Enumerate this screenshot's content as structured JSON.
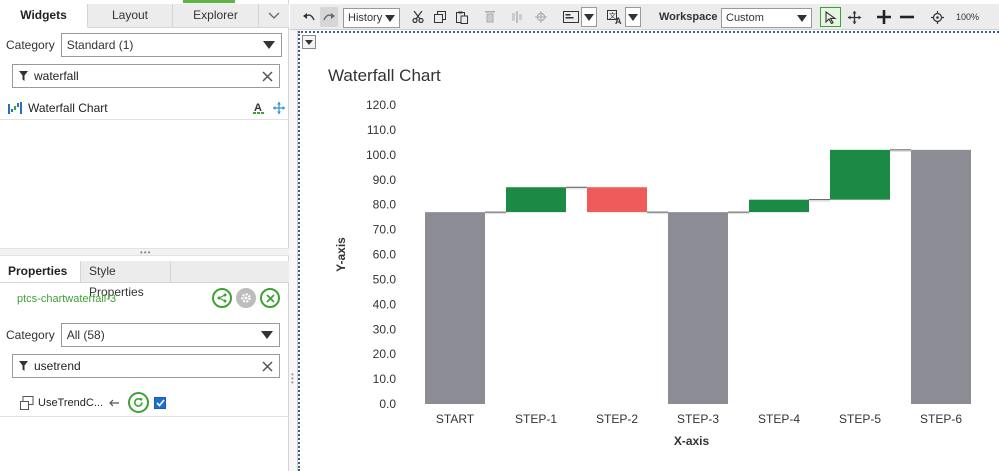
{
  "left_panel": {
    "tabs": [
      {
        "label": "Widgets",
        "active": true
      },
      {
        "label": "Layout",
        "active": false
      },
      {
        "label": "Explorer",
        "active": false
      }
    ],
    "category": {
      "label": "Category",
      "value": "Standard (1)"
    },
    "search": {
      "value": "waterfall"
    },
    "widget_list": [
      {
        "label": "Waterfall Chart",
        "icon": "waterfall-chart-icon"
      }
    ]
  },
  "properties": {
    "tabs": [
      {
        "label": "Properties",
        "active": true
      },
      {
        "label": "Style Properties",
        "active": false
      }
    ],
    "widget_id": "ptcs-chartwaterfall-3",
    "category": {
      "label": "Category",
      "value": "All (58)"
    },
    "search": {
      "value": "usetrend"
    },
    "rows": [
      {
        "name": "UseTrendC...",
        "checked": true
      }
    ]
  },
  "toolbar": {
    "history_label": "History",
    "workspace_label": "Workspace",
    "workspace_value": "Custom",
    "zoom": "100%"
  },
  "colors": {
    "accent_green": "#5fb446",
    "gray_bar": "#8c8c94",
    "increase": "#1a8a45",
    "decrease": "#ef5a5a"
  },
  "chart_data": {
    "type": "waterfall",
    "title": "Waterfall Chart",
    "xlabel": "X-axis",
    "ylabel": "Y-axis",
    "ylim": [
      0,
      120
    ],
    "yticks": [
      "0.0",
      "10.0",
      "20.0",
      "30.0",
      "40.0",
      "50.0",
      "60.0",
      "70.0",
      "80.0",
      "90.0",
      "100.0",
      "110.0",
      "120.0"
    ],
    "categories": [
      "START",
      "STEP-1",
      "STEP-2",
      "STEP-3",
      "STEP-4",
      "STEP-5",
      "STEP-6"
    ],
    "bars": [
      {
        "kind": "total",
        "base": 0,
        "top": 77
      },
      {
        "kind": "increase",
        "base": 77,
        "top": 87
      },
      {
        "kind": "decrease",
        "base": 87,
        "top": 77
      },
      {
        "kind": "total",
        "base": 0,
        "top": 77
      },
      {
        "kind": "increase",
        "base": 77,
        "top": 82
      },
      {
        "kind": "increase",
        "base": 82,
        "top": 102
      },
      {
        "kind": "total",
        "base": 0,
        "top": 102
      }
    ]
  }
}
